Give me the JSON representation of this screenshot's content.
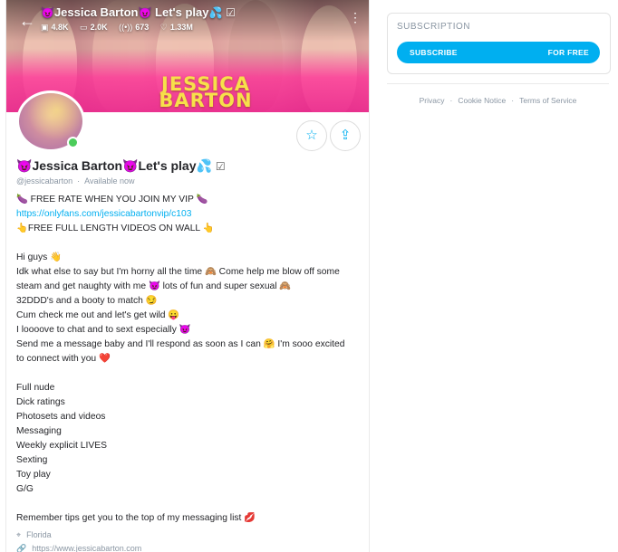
{
  "header": {
    "title_prefix_emoji": "😈",
    "title_name": "Jessica Barton",
    "title_mid_emoji": "😈",
    "title_suffix": "Let's play",
    "title_end_emoji": "💦",
    "verified_glyph": "☑",
    "stats": [
      {
        "icon": "image-icon",
        "glyph": "▣",
        "value": "4.8K"
      },
      {
        "icon": "video-icon",
        "glyph": "▭",
        "value": "2.0K"
      },
      {
        "icon": "stream-icon",
        "glyph": "((•))",
        "value": "673"
      },
      {
        "icon": "heart-icon",
        "glyph": "♡",
        "value": "1.33M"
      }
    ],
    "back_glyph": "←",
    "more_glyph": "⋮"
  },
  "cover": {
    "brand_line1": "JESSICA",
    "brand_line2": "BARTON"
  },
  "profile": {
    "name_prefix": "😈",
    "name": "Jessica Barton",
    "name_mid": "😈",
    "name_suffix": "Let's play",
    "name_end": "💦",
    "verified": "☑",
    "handle": "@jessicabarton",
    "status": "Available now",
    "favorite_glyph": "☆",
    "share_glyph": "⇪"
  },
  "bio": {
    "lines": [
      {
        "type": "text",
        "text": "🍆 FREE RATE WHEN YOU JOIN MY VIP 🍆"
      },
      {
        "type": "link",
        "text": "https://onlyfans.com/jessicabartonvip/c103"
      },
      {
        "type": "text",
        "text": "👆FREE FULL LENGTH VIDEOS ON WALL 👆"
      },
      {
        "type": "blank",
        "text": ""
      },
      {
        "type": "text",
        "text": "Hi guys 👋"
      },
      {
        "type": "text",
        "text": "Idk what else to say but I'm horny all the time 🙈 Come help me blow off some"
      },
      {
        "type": "text",
        "text": "steam and get naughty with me 😈 lots of fun and super sexual 🙈"
      },
      {
        "type": "text",
        "text": "32DDD's and a booty to match 😏"
      },
      {
        "type": "text",
        "text": "Cum check me out and let's get wild 😛"
      },
      {
        "type": "text",
        "text": "I loooove to chat and to sext especially 😈"
      },
      {
        "type": "text",
        "text": "Send me a message baby and I'll respond as soon as I can 🤗 I'm sooo excited"
      },
      {
        "type": "text",
        "text": "to connect with you ❤️"
      },
      {
        "type": "blank",
        "text": ""
      },
      {
        "type": "text",
        "text": "Full nude"
      },
      {
        "type": "text",
        "text": "Dick ratings"
      },
      {
        "type": "text",
        "text": "Photosets and videos"
      },
      {
        "type": "text",
        "text": "Messaging"
      },
      {
        "type": "text",
        "text": "Weekly explicit LIVES"
      },
      {
        "type": "text",
        "text": "Sexting"
      },
      {
        "type": "text",
        "text": "Toy play"
      },
      {
        "type": "text",
        "text": "G/G"
      },
      {
        "type": "blank",
        "text": ""
      },
      {
        "type": "text",
        "text": "Remember tips get you to the top of my messaging list 💋"
      }
    ],
    "location_glyph": "⌖",
    "location": "Florida",
    "website_glyph": "🔗",
    "website": "https://www.jessicabarton.com"
  },
  "subscription": {
    "title": "SUBSCRIPTION",
    "button_label": "SUBSCRIBE",
    "button_price": "FOR FREE"
  },
  "footer": {
    "links": [
      "Privacy",
      "Cookie Notice",
      "Terms of Service"
    ],
    "separator": "·"
  },
  "colors": {
    "accent": "#00aff0",
    "online": "#4bcc5a",
    "muted": "#8a96a3"
  }
}
